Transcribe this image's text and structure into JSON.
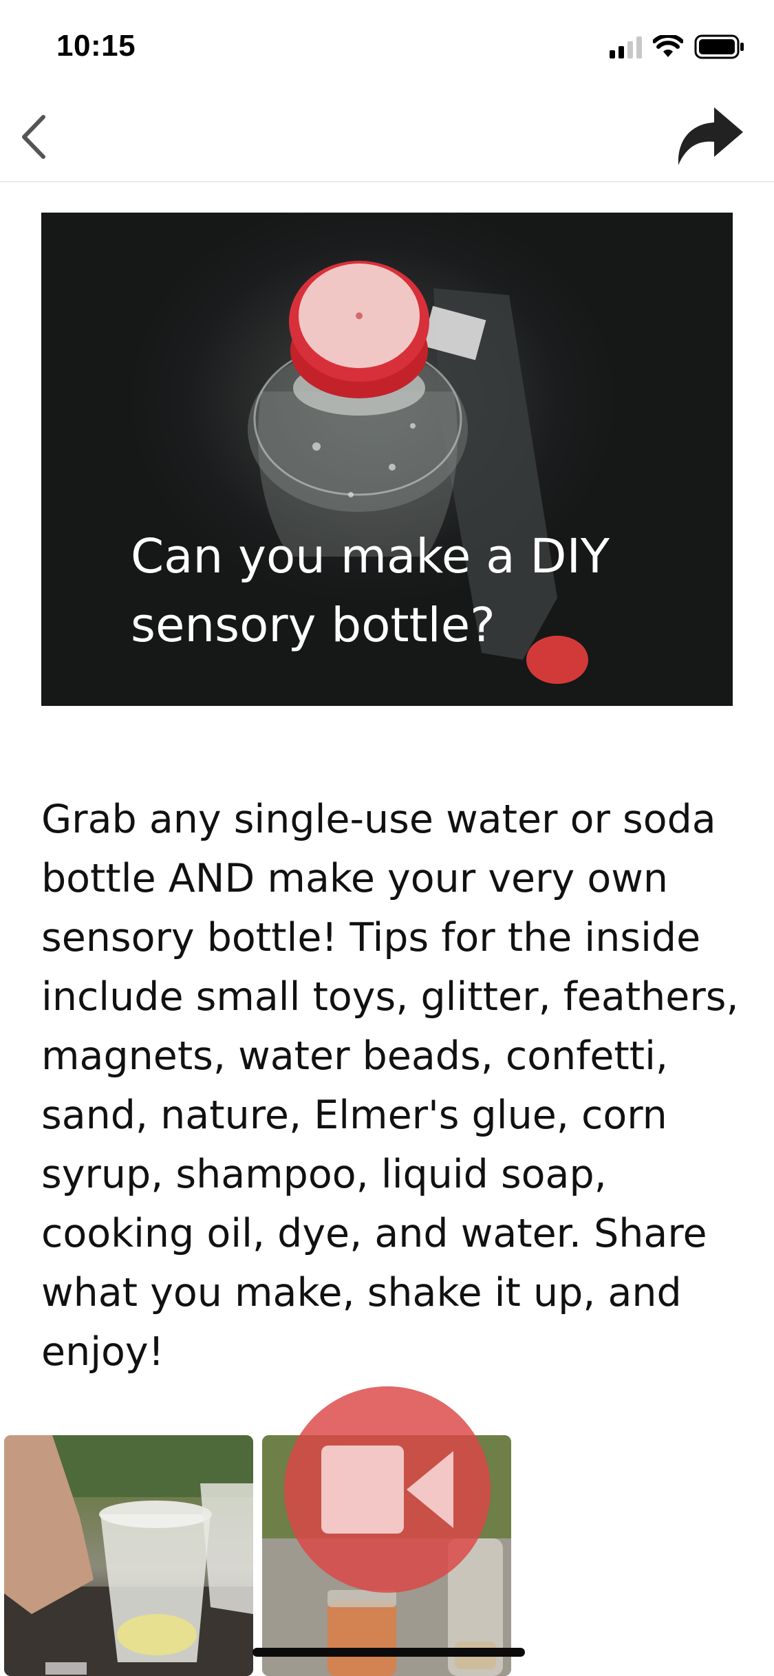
{
  "status_bar": {
    "time": "10:15",
    "icons": [
      "cellular-signal-icon",
      "wifi-icon",
      "battery-icon"
    ]
  },
  "nav": {
    "back_icon": "chevron-left-icon",
    "share_icon": "share-arrow-icon"
  },
  "hero": {
    "title": "Can you make a DIY sensory bottle?"
  },
  "description": "Grab any single-use water or soda bottle AND make your very own sensory bottle! Tips for the inside include small toys, glitter, feathers, magnets, water beads, confetti, sand, nature, Elmer's glue, corn syrup, shampoo, liquid soap, cooking oil, dye, and water. Share what you make, shake it up, and enjoy!",
  "media": {
    "fab_icon": "video-camera-icon"
  },
  "colors": {
    "fab": "#dc4646",
    "hero_bg": "#1b1c1d",
    "text": "#111111"
  }
}
